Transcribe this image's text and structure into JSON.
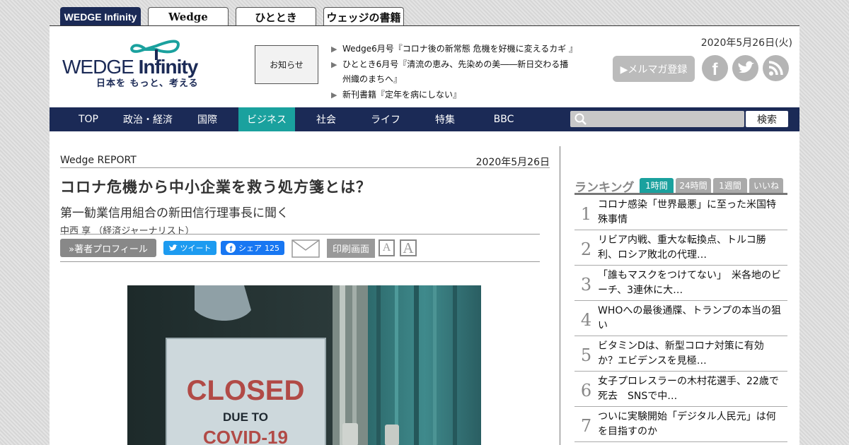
{
  "site_tabs": [
    {
      "label": "WEDGE Infinity",
      "active": true
    },
    {
      "label": "Wedge",
      "active": false
    },
    {
      "label": "ひととき",
      "active": false
    },
    {
      "label": "ウェッジの書籍",
      "active": false
    }
  ],
  "header": {
    "logo_text_wedge": "WEDGE",
    "logo_text_infinity": "Infinity",
    "tagline": "日本を もっと、考える",
    "notice_label": "お知らせ",
    "news": [
      "Wedge6月号『コロナ後の新常態 危機を好機に変えるカギ 』",
      "ひととき6月号『清流の恵み、先染めの美――新日交わる播州織のまちへ』",
      "新刊書籍『定年を病にしない』"
    ],
    "date": "2020年5月26日(火)",
    "newsletter_label": "▶メルマガ登録",
    "social_icons": [
      "facebook-icon",
      "twitter-icon",
      "rss-icon"
    ]
  },
  "nav": {
    "items": [
      "TOP",
      "政治・経済",
      "国際",
      "ビジネス",
      "社会",
      "ライフ",
      "特集",
      "BBC"
    ],
    "active_index": 3,
    "search_placeholder": "",
    "search_button": "検索"
  },
  "article": {
    "category": "Wedge REPORT",
    "date": "2020年5月26日",
    "headline": "コロナ危機から中小企業を救う処方箋とは？",
    "subheadline": "第一勧業信用組合の新田信行理事長に聞く",
    "author": "中西 享 （経済ジャーナリスト）",
    "profile_button": "»著者プロフィール",
    "tweet_label": "ツイート",
    "share_label": "シェア",
    "share_count": "125",
    "print_label": "印刷画面",
    "font_small_label": "A",
    "font_large_label": "A",
    "photo_sign_line1": "CLOSED",
    "photo_sign_line2": "DUE TO",
    "photo_sign_line3": "COVID-19"
  },
  "ranking": {
    "title": "ランキング",
    "tabs": [
      "1時間",
      "24時間",
      "1週間",
      "いいね"
    ],
    "active_tab": 0,
    "items": [
      {
        "rank": "1",
        "text": "コロナ感染「世界最悪」に至った米国特殊事情"
      },
      {
        "rank": "2",
        "text": "リビア内戦、重大な転換点、トルコ勝利、ロシア敗北の代理…"
      },
      {
        "rank": "3",
        "text": "「誰もマスクをつけてない」　米各地のビーチ、3連休に大…"
      },
      {
        "rank": "4",
        "text": "WHOへの最後通牒、トランプの本当の狙い"
      },
      {
        "rank": "5",
        "text": "ビタミンDは、新型コロナ対策に有効か？エビデンスを見極…"
      },
      {
        "rank": "6",
        "text": "女子プロレスラーの木村花選手、22歳で死去　SNSで中…"
      },
      {
        "rank": "7",
        "text": "ついに実験開始「デジタル人民元」は何を目指すのか"
      }
    ]
  },
  "colors": {
    "navy": "#1b2a56",
    "teal_active": "#1aa19e",
    "gray_button": "#888888"
  }
}
